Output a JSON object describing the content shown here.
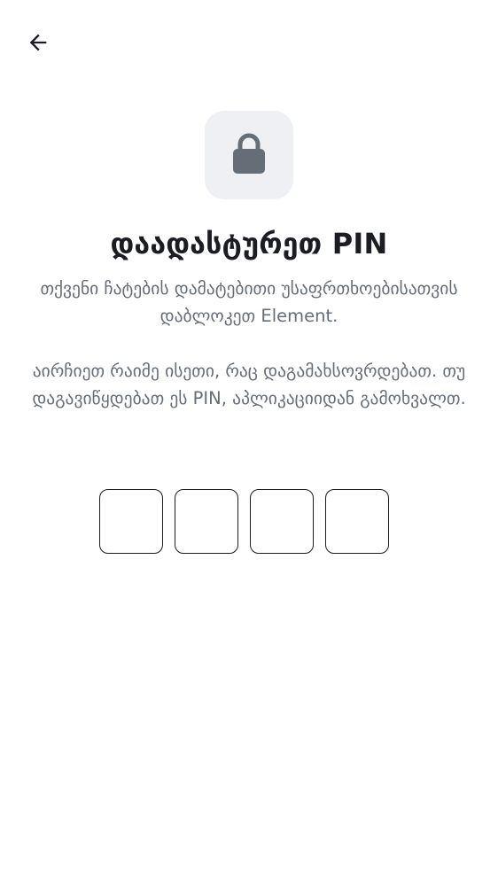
{
  "icons": {
    "back": "arrow-left-icon",
    "lock": "lock-icon"
  },
  "colors": {
    "title": "#1b1d22",
    "secondary_text": "#656d77",
    "icon_tile_bg": "#eef0f4",
    "lock_fill": "#656d77",
    "pin_border": "#1b1d22"
  },
  "header": {
    "title": "დაადასტურეთ PIN"
  },
  "description": {
    "paragraph_1": "თქვენი ჩატების დამატებითი უსაფრთხოებისათვის დაბლოკეთ Element.",
    "paragraph_2": "აირჩიეთ რაიმე ისეთი, რაც დაგამახსოვრდებათ. თუ დაგავიწყდებათ ეს PIN, აპლიკაციიდან გამოხვალთ."
  },
  "pin": {
    "digits": [
      "",
      "",
      "",
      ""
    ]
  }
}
